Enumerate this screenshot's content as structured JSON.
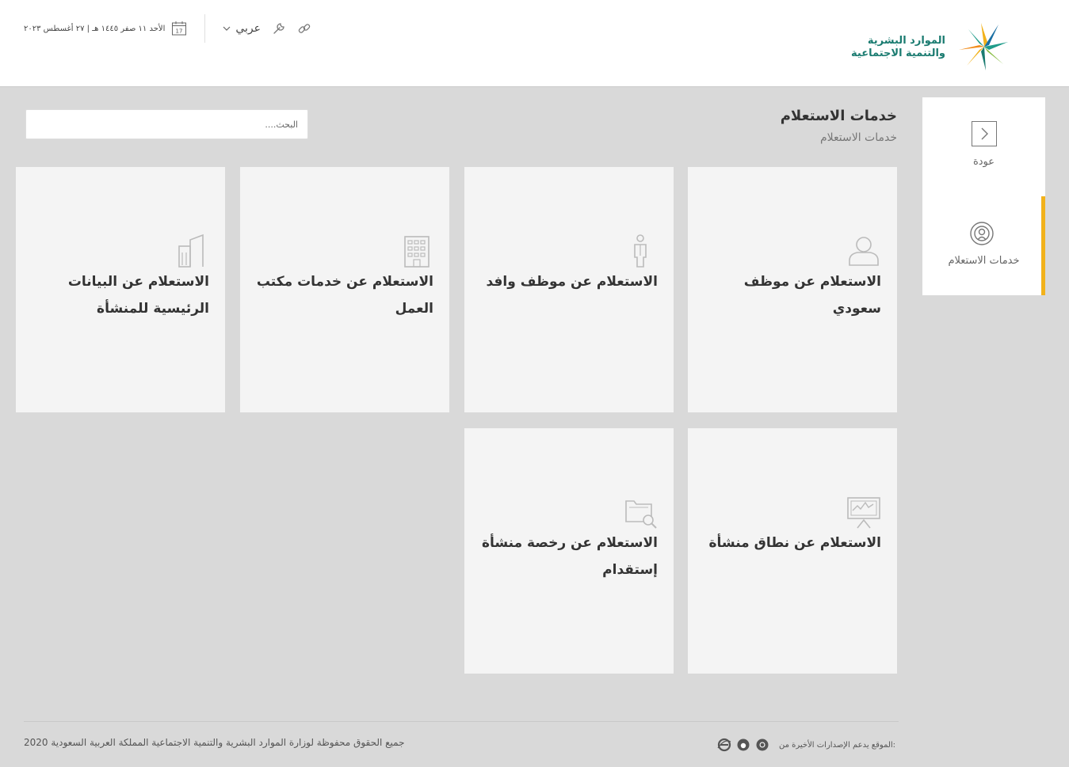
{
  "header": {
    "logo_line1": "الموارد البشرية",
    "logo_line2": "والتنمية الاجتماعية",
    "date_text": "الأحد ١١ صفر ١٤٤٥ هـ | ٢٧ أغسطس ٢٠٢٣",
    "calendar_day": "17",
    "language": "عربي"
  },
  "sidebar": {
    "back_label": "عودة",
    "services_label": "خدمات الاستعلام"
  },
  "main": {
    "title": "خدمات الاستعلام",
    "subtitle": "خدمات الاستعلام",
    "search_placeholder": "البحث...."
  },
  "cards": [
    {
      "title": "الاستعلام عن موظف سعودي",
      "icon": "person-icon"
    },
    {
      "title": "الاستعلام عن موظف وافد",
      "icon": "standing-person-icon"
    },
    {
      "title": "الاستعلام عن خدمات مكتب العمل",
      "icon": "building-icon"
    },
    {
      "title": "الاستعلام عن البيانات الرئيسية للمنشأة",
      "icon": "office-towers-icon"
    },
    {
      "title": "الاستعلام عن نطاق منشأة",
      "icon": "presentation-chart-icon"
    },
    {
      "title": "الاستعلام عن رخصة منشأة إستقدام",
      "icon": "folder-search-icon"
    }
  ],
  "footer": {
    "copyright": "جميع الحقوق محفوظة لوزارة الموارد البشرية والتنمية الاجتماعية المملكة العربية السعودية 2020",
    "browsers_text": "الموقع يدعم الإصدارات الأخيرة من:"
  },
  "colors": {
    "accent": "#f2b21b",
    "brand_green": "#1a7b70",
    "background": "#d9d9d9",
    "card": "#f4f4f4"
  }
}
